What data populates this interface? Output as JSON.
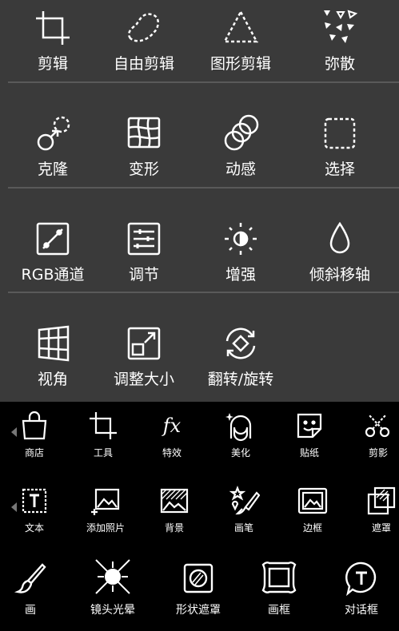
{
  "editor_tools": {
    "row1": [
      "剪辑",
      "自由剪辑",
      "图形剪辑",
      "弥散"
    ],
    "row2": [
      "克隆",
      "变形",
      "动感",
      "选择"
    ],
    "row3": [
      "RGB通道",
      "调节",
      "增强",
      "倾斜移轴"
    ],
    "row4": [
      "视角",
      "调整大小",
      "翻转/旋转"
    ]
  },
  "bottom_bar": {
    "row1": [
      "商店",
      "工具",
      "特效",
      "美化",
      "贴纸",
      "剪影"
    ],
    "row2": [
      "文本",
      "添加照片",
      "背景",
      "画笔",
      "边框",
      "遮罩"
    ],
    "row3": [
      "画",
      "镜头光晕",
      "形状遮罩",
      "画框",
      "对话框"
    ]
  },
  "colors": {
    "panel_bg": "#3a3a3a",
    "separator": "#595959",
    "bottom_bg": "#000000",
    "icon": "#ffffff"
  }
}
